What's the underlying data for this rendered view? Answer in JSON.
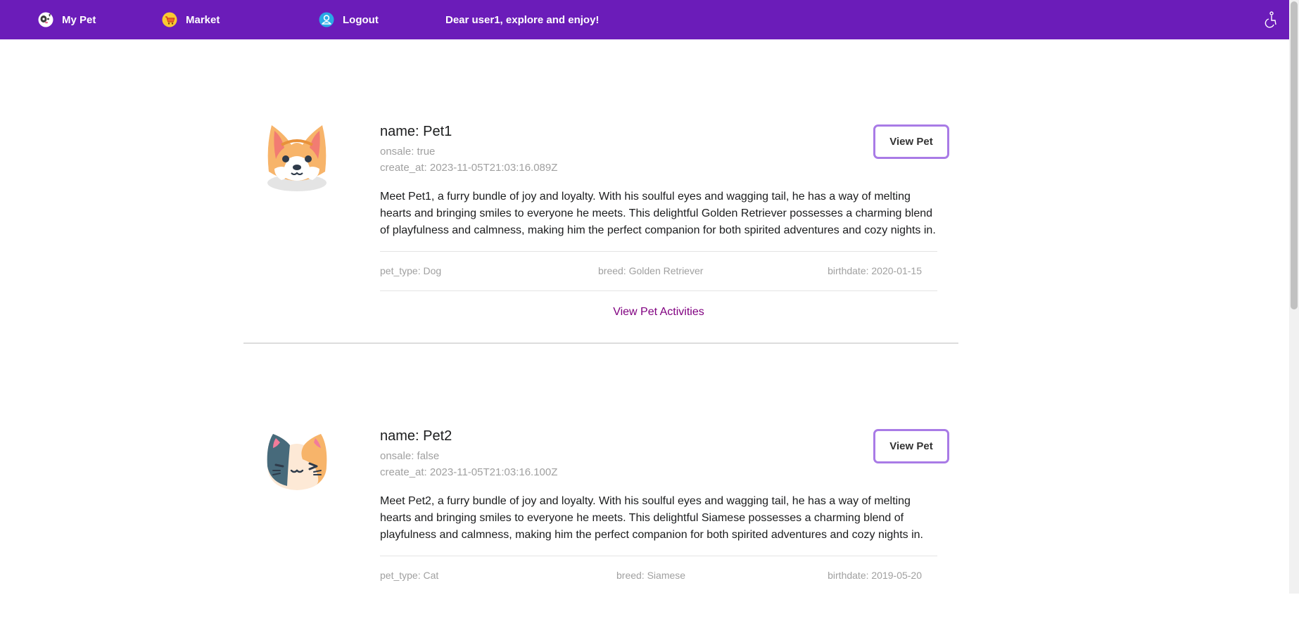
{
  "nav": {
    "my_pet": "My Pet",
    "market": "Market",
    "logout": "Logout",
    "greeting": "Dear user1, explore and enjoy!",
    "accessibility_icon": "accessibility-icon",
    "colors": {
      "bar": "#6b1cb9",
      "text": "#ffffff"
    }
  },
  "pets": [
    {
      "avatar_icon": "corgi-dog-face-icon",
      "name": "name: Pet1",
      "onsale": "onsale: true",
      "created": "create_at: 2023-11-05T21:03:16.089Z",
      "description": "Meet Pet1, a furry bundle of joy and loyalty. With his soulful eyes and wagging tail, he has a way of melting hearts and bringing smiles to everyone he meets. This delightful Golden Retriever possesses a charming blend of playfulness and calmness, making him the perfect companion for both spirited adventures and cozy nights in.",
      "view_button": "View Pet",
      "pet_type": "pet_type: Dog",
      "breed": "breed: Golden Retriever",
      "birthdate": "birthdate: 2020-01-15",
      "activities_link": "View Pet Activities"
    },
    {
      "avatar_icon": "calico-cat-face-icon",
      "name": "name: Pet2",
      "onsale": "onsale: false",
      "created": "create_at: 2023-11-05T21:03:16.100Z",
      "description": "Meet Pet2, a furry bundle of joy and loyalty. With his soulful eyes and wagging tail, he has a way of melting hearts and bringing smiles to everyone he meets. This delightful Siamese possesses a charming blend of playfulness and calmness, making him the perfect companion for both spirited adventures and cozy nights in.",
      "view_button": "View Pet",
      "pet_type": "pet_type: Cat",
      "breed": "breed: Siamese",
      "birthdate": "birthdate: 2019-05-20"
    }
  ],
  "colors": {
    "button_border": "#a97be6",
    "link": "#800080",
    "muted_text": "#a0a0a0"
  }
}
